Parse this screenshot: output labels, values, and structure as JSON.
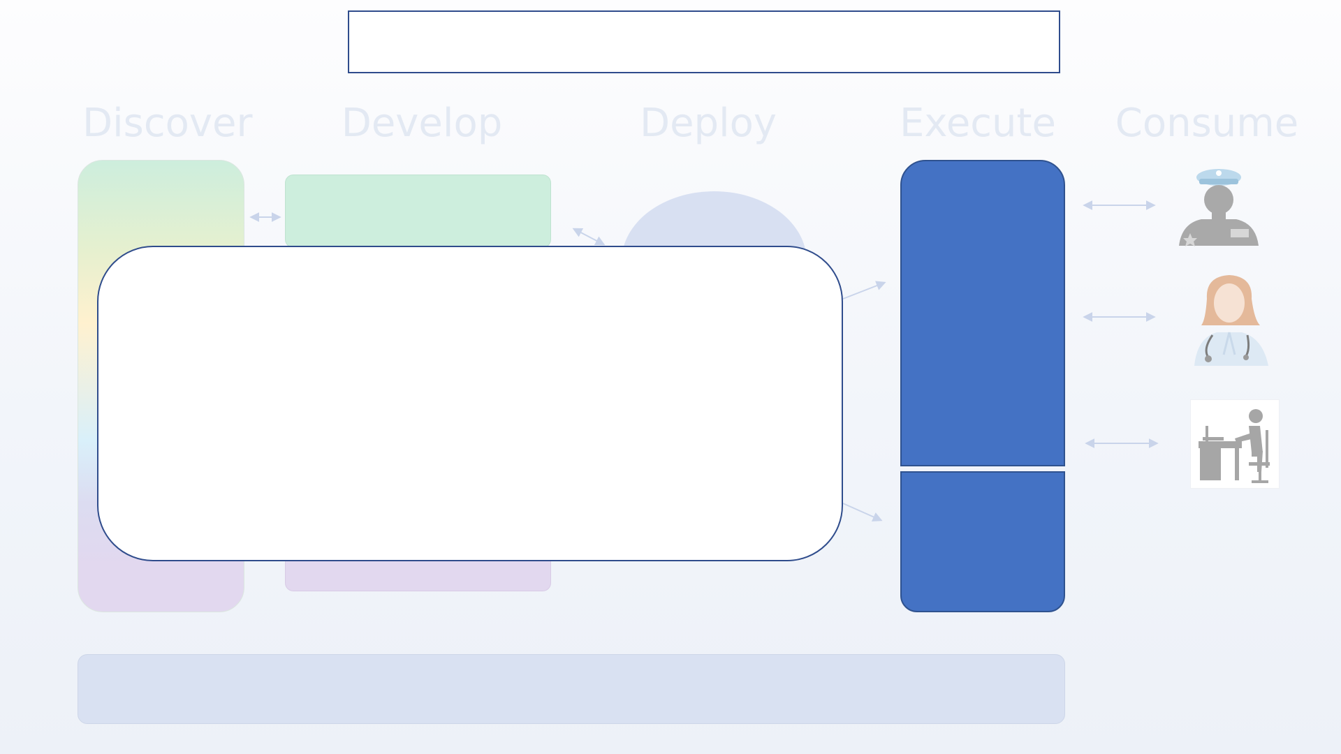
{
  "phases": [
    "Discover",
    "Develop",
    "Deploy",
    "Execute",
    "Consume"
  ],
  "colors": {
    "execute_fill": "#4472c4",
    "execute_border": "#2f528f",
    "panel_border": "#2f4c8c",
    "label_color": "#e3e9f3",
    "bottom_bar": "#d9e1f2"
  },
  "consumers": [
    {
      "icon": "police-officer-icon"
    },
    {
      "icon": "doctor-icon"
    },
    {
      "icon": "office-worker-icon"
    }
  ]
}
